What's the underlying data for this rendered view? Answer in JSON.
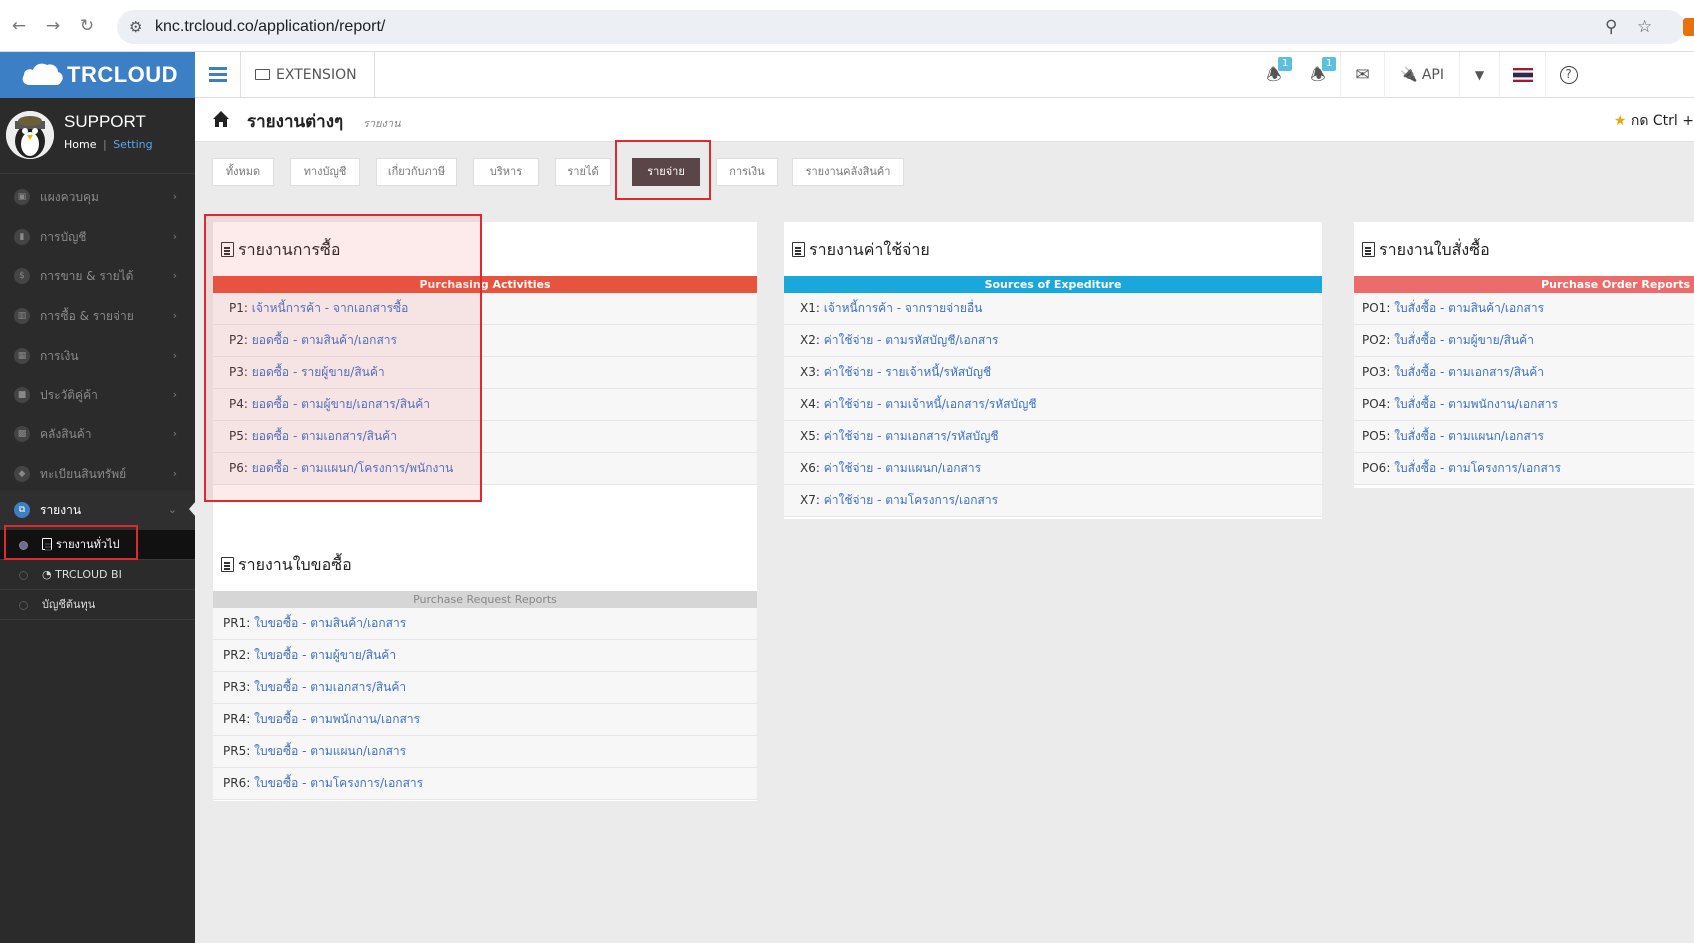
{
  "browser": {
    "url": "knc.trcloud.co/application/report/"
  },
  "brand": {
    "name": "TRCLOUD"
  },
  "topnav": {
    "extension_label": "EXTENSION",
    "notif1_count": "1",
    "notif2_count": "1",
    "api_label": "API"
  },
  "user": {
    "name": "SUPPORT",
    "home_link": "Home",
    "separator": "|",
    "setting_link": "Setting"
  },
  "sidebar": {
    "items": [
      {
        "label": "แผงควบคุม",
        "icon": "monitor-icon"
      },
      {
        "label": "การบัญชี",
        "icon": "book-icon"
      },
      {
        "label": "การขาย & รายได้",
        "icon": "dollar-icon"
      },
      {
        "label": "การซื้อ & รายจ่าย",
        "icon": "cart-icon"
      },
      {
        "label": "การเงิน",
        "icon": "calendar-icon"
      },
      {
        "label": "ประวัติคู่ค้า",
        "icon": "contact-icon"
      },
      {
        "label": "คลังสินค้า",
        "icon": "boxes-icon"
      },
      {
        "label": "ทะเบียนสินทรัพย์",
        "icon": "diamond-icon"
      },
      {
        "label": "รายงาน",
        "icon": "copy-icon"
      }
    ],
    "sub_items": [
      {
        "label": "รายงานทั่วไป"
      },
      {
        "label": "TRCLOUD BI"
      },
      {
        "label": "บัญชีต้นทุน"
      }
    ]
  },
  "page": {
    "title": "รายงานต่างๆ",
    "subtitle": "รายงาน",
    "ctrl_hint": "กด Ctrl +"
  },
  "filters": [
    "ทั้งหมด",
    "ทางบัญชี",
    "เกี่ยวกับภาษี",
    "บริหาร",
    "รายได้",
    "รายจ่าย",
    "การเงิน",
    "รายงานคลังสินค้า"
  ],
  "active_filter": "รายจ่าย",
  "panels": {
    "purchase": {
      "title": "รายงานการซื้อ",
      "bar": "Purchasing Activities",
      "bar_color": "#e8533d",
      "rows": [
        {
          "code": "P1:",
          "label": "เจ้าหนี้การค้า - จากเอกสารซื้อ"
        },
        {
          "code": "P2:",
          "label": "ยอดซื้อ - ตามสินค้า/เอกสาร"
        },
        {
          "code": "P3:",
          "label": "ยอดซื้อ - รายผู้ขาย/สินค้า"
        },
        {
          "code": "P4:",
          "label": "ยอดซื้อ - ตามผู้ขาย/เอกสาร/สินค้า"
        },
        {
          "code": "P5:",
          "label": "ยอดซื้อ - ตามเอกสาร/สินค้า"
        },
        {
          "code": "P6:",
          "label": "ยอดซื้อ - ตามแผนก/โครงการ/พนักงาน"
        }
      ]
    },
    "expense": {
      "title": "รายงานค่าใช้จ่าย",
      "bar": "Sources of Expediture",
      "bar_color": "#1aa7dc",
      "rows": [
        {
          "code": "X1:",
          "label": "เจ้าหนี้การค้า - จากรายจ่ายอื่น"
        },
        {
          "code": "X2:",
          "label": "ค่าใช้จ่าย - ตามรหัสบัญชี/เอกสาร"
        },
        {
          "code": "X3:",
          "label": "ค่าใช้จ่าย - รายเจ้าหนี้/รหัสบัญชี"
        },
        {
          "code": "X4:",
          "label": "ค่าใช้จ่าย - ตามเจ้าหนี้/เอกสาร/รหัสบัญชี"
        },
        {
          "code": "X5:",
          "label": "ค่าใช้จ่าย - ตามเอกสาร/รหัสบัญชี"
        },
        {
          "code": "X6:",
          "label": "ค่าใช้จ่าย - ตามแผนก/เอกสาร"
        },
        {
          "code": "X7:",
          "label": "ค่าใช้จ่าย - ตามโครงการ/เอกสาร"
        }
      ]
    },
    "po": {
      "title": "รายงานใบสั่งซื้อ",
      "bar": "Purchase Order Reports",
      "bar_color": "#ec6b6b",
      "rows": [
        {
          "code": "PO1:",
          "label": "ใบสั่งซื้อ - ตามสินค้า/เอกสาร"
        },
        {
          "code": "PO2:",
          "label": "ใบสั่งซื้อ - ตามผู้ขาย/สินค้า"
        },
        {
          "code": "PO3:",
          "label": "ใบสั่งซื้อ - ตามเอกสาร/สินค้า"
        },
        {
          "code": "PO4:",
          "label": "ใบสั่งซื้อ - ตามพนักงาน/เอกสาร"
        },
        {
          "code": "PO5:",
          "label": "ใบสั่งซื้อ - ตามแผนก/เอกสาร"
        },
        {
          "code": "PO6:",
          "label": "ใบสั่งซื้อ - ตามโครงการ/เอกสาร"
        }
      ]
    },
    "pr": {
      "title": "รายงานใบขอซื้อ",
      "bar": "Purchase Request Reports",
      "bar_color": "#d6d6d6",
      "rows": [
        {
          "code": "PR1:",
          "label": "ใบขอซื้อ - ตามสินค้า/เอกสาร"
        },
        {
          "code": "PR2:",
          "label": "ใบขอซื้อ - ตามผู้ขาย/สินค้า"
        },
        {
          "code": "PR3:",
          "label": "ใบขอซื้อ - ตามเอกสาร/สินค้า"
        },
        {
          "code": "PR4:",
          "label": "ใบขอซื้อ - ตามพนักงาน/เอกสาร"
        },
        {
          "code": "PR5:",
          "label": "ใบขอซื้อ - ตามแผนก/เอกสาร"
        },
        {
          "code": "PR6:",
          "label": "ใบขอซื้อ - ตามโครงการ/เอกสาร"
        }
      ]
    }
  },
  "colors": {
    "brand": "#3c7fc4",
    "sidebar_bg": "#2b2b2b",
    "active_filter_bg": "#5a4648",
    "link": "#3f70c4",
    "highlight_border": "#e0282e"
  }
}
